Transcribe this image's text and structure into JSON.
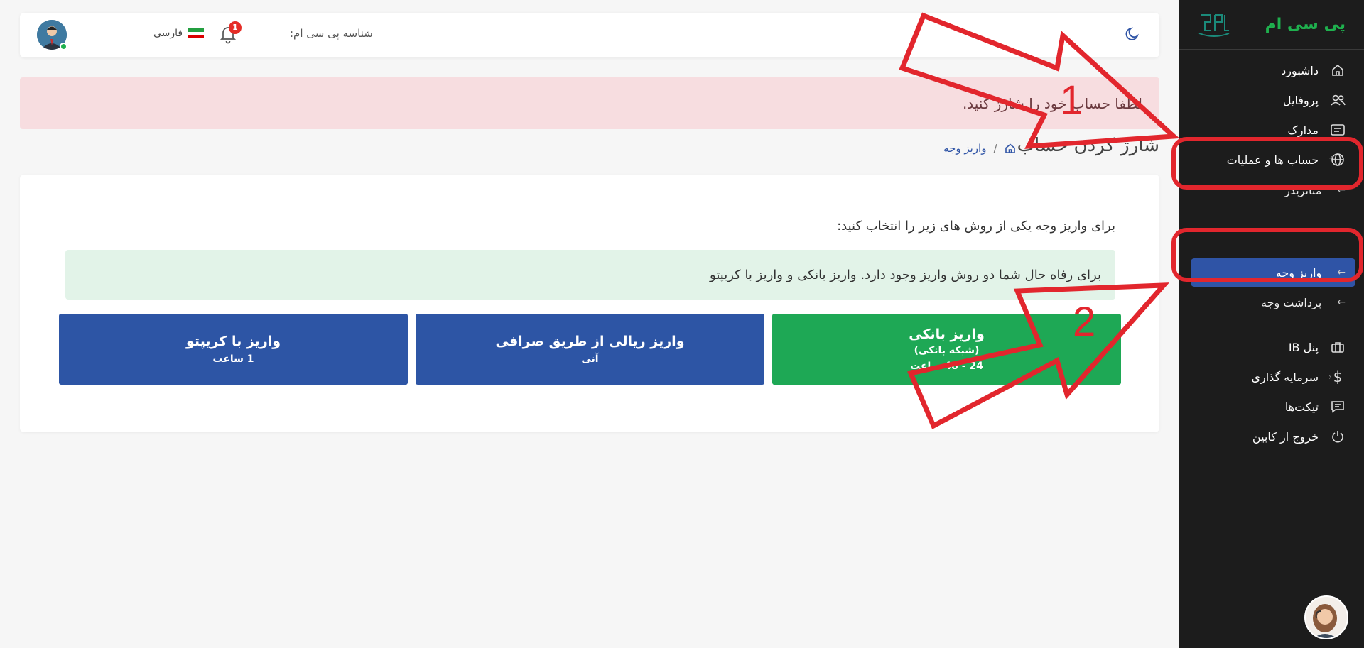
{
  "sidebar": {
    "brand": "پی سی ام",
    "items": {
      "dashboard": "داشبورد",
      "profile": "پروفایل",
      "documents": "مدارک",
      "accounts": "حساب ها و عملیات",
      "ib_panel": "پنل IB",
      "investment": "سرمایه گذاری",
      "tickets": "تیکت‌ها",
      "logout": "خروج از کابین"
    },
    "sub_items": {
      "metatrader": "متاتریدر",
      "deposit": "واریز وجه",
      "withdraw": "برداشت وجه"
    }
  },
  "topbar": {
    "account_id_label": "شناسه پی سی ام:",
    "notification_count": "1",
    "language": "فارسی"
  },
  "alert": {
    "text": "لطفا حساب خود را شارژ کنید."
  },
  "page": {
    "title": "شارژ کردن حساب",
    "breadcrumb_current": "واریز وجه",
    "breadcrumb_separator": "/"
  },
  "card": {
    "intro": "برای واریز وجه یکی از روش های زیر را انتخاب کنید:",
    "info": "برای رفاه حال شما دو روش واریز وجود دارد. واریز بانکی و واریز با کریپتو",
    "methods": {
      "bank": {
        "title": "واریز بانکی",
        "subtitle": "(شبکه بانکی)",
        "time": "24 - 48 ساعت"
      },
      "exchange": {
        "title": "واریز ریالی از طریق صرافی",
        "time": "آنی"
      },
      "crypto": {
        "title": "واریز با کریپتو",
        "time": "1 ساعت"
      }
    }
  },
  "annotations": {
    "label_1": "1",
    "label_2": "2",
    "color": "#e2262d"
  },
  "colors": {
    "sidebar_bg": "#1c1c1c",
    "brand_green": "#1fb04e",
    "primary_blue": "#2d55a5",
    "success_green": "#1ea855",
    "alert_danger_bg": "#f7dde0",
    "alert_success_bg": "#e2f3e8"
  }
}
